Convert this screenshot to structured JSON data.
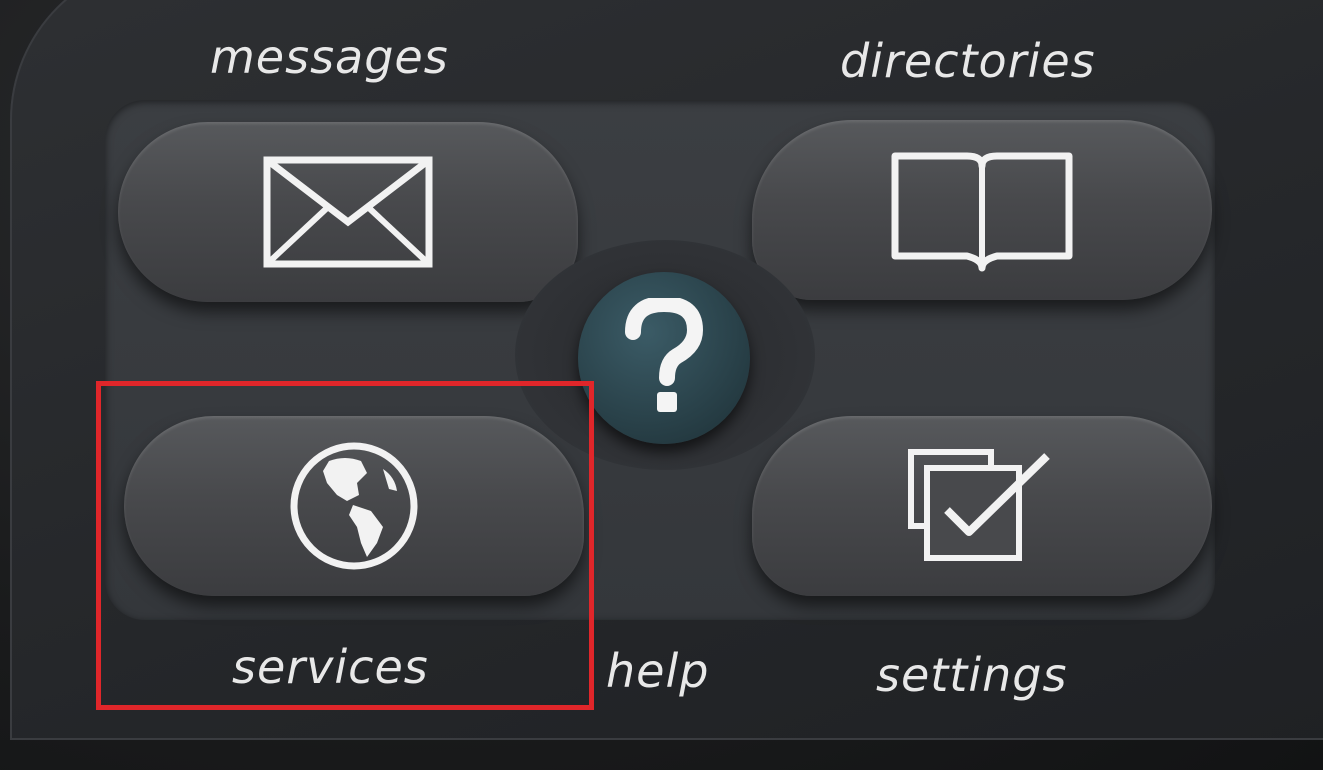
{
  "keys": {
    "messages": {
      "label": "messages",
      "icon": "envelope-icon"
    },
    "directories": {
      "label": "directories",
      "icon": "book-icon"
    },
    "help": {
      "label": "help",
      "icon": "question-mark-icon"
    },
    "services": {
      "label": "services",
      "icon": "globe-icon"
    },
    "settings": {
      "label": "settings",
      "icon": "checkbox-icon"
    }
  },
  "highlight": {
    "color": "#e0262a"
  },
  "colors": {
    "help_key": "#294149",
    "key_face": "#48494c",
    "label_text": "#e8e8e8"
  }
}
